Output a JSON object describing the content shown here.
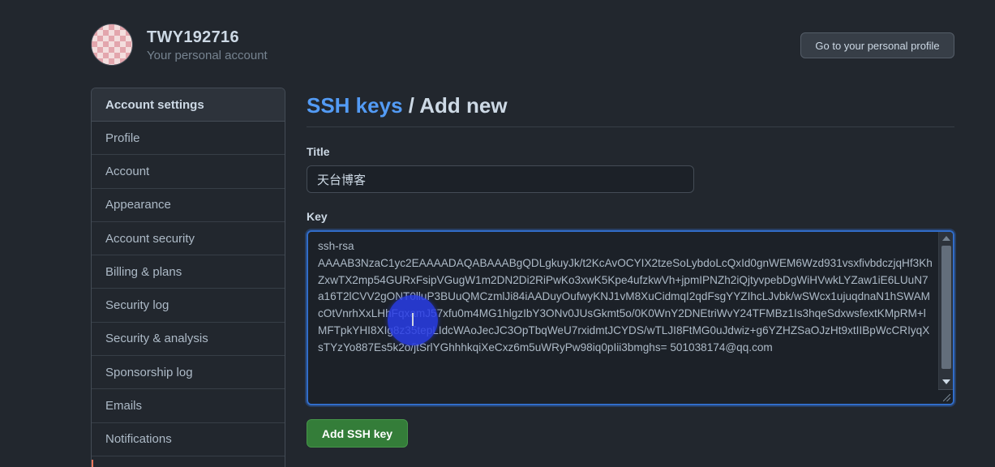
{
  "header": {
    "username": "TWY192716",
    "account_type": "Your personal account",
    "profile_button": "Go to your personal profile"
  },
  "sidebar": {
    "heading": "Account settings",
    "items": [
      {
        "label": "Profile"
      },
      {
        "label": "Account"
      },
      {
        "label": "Appearance"
      },
      {
        "label": "Account security"
      },
      {
        "label": "Billing & plans"
      },
      {
        "label": "Security log"
      },
      {
        "label": "Security & analysis"
      },
      {
        "label": "Sponsorship log"
      },
      {
        "label": "Emails"
      },
      {
        "label": "Notifications"
      }
    ]
  },
  "main": {
    "breadcrumb_link": "SSH keys",
    "breadcrumb_separator": " / ",
    "breadcrumb_current": "Add new",
    "title_label": "Title",
    "title_value": "天台博客",
    "key_label": "Key",
    "key_value": "ssh-rsa\nAAAAB3NzaC1yc2EAAAADAQABAAABgQDLgkuyJk/t2KcAvOCYIX2tzeSoLybdoLcQxId0gnWEM6Wzd931vsxfivbdczjqHf3KhZxwTX2mp54GURxFsipVGugW1m2DN2Di2RiPwKo3xwK5Kpe4ufzkwVh+jpmIPNZh2iQjtyvpebDgWiHVwkLYZaw1iE6LUuN7a16T2lCVV2gONT0lluP3BUuQMCzmlJi84iAADuyOufwyKNJ1vM8XuCidmqI2qdFsgYYZIhcLJvbk/wSWcx1ujuqdnaN1hSWAMcOtVnrhXxLHhFqxamJ57xfu0m4MG1hlgzIbY3ONv0JUsGkmt5o/0K0WnY2DNEtriWvY24TFMBz1Is3hqeSdxwsfextKMpRM+lMFTpkYHI8XIg8z35tepLIdcWAoJecJC3OpTbqWeU7rxidmtJCYDS/wTLJI8FtMG0uJdwiz+g6YZHZSaOJzHt9xtIIBpWcCRIyqXsTYzYo887Es5k2o/jtSrlYGhhhkqiXeCxz6m5uWRyPw98iq0pIii3bmghs= 501038174@qq.com",
    "add_button": "Add SSH key"
  },
  "colors": {
    "background": "#22272e",
    "link": "#539bf5",
    "primary_button": "#347d39",
    "focus_border": "#316dca"
  }
}
